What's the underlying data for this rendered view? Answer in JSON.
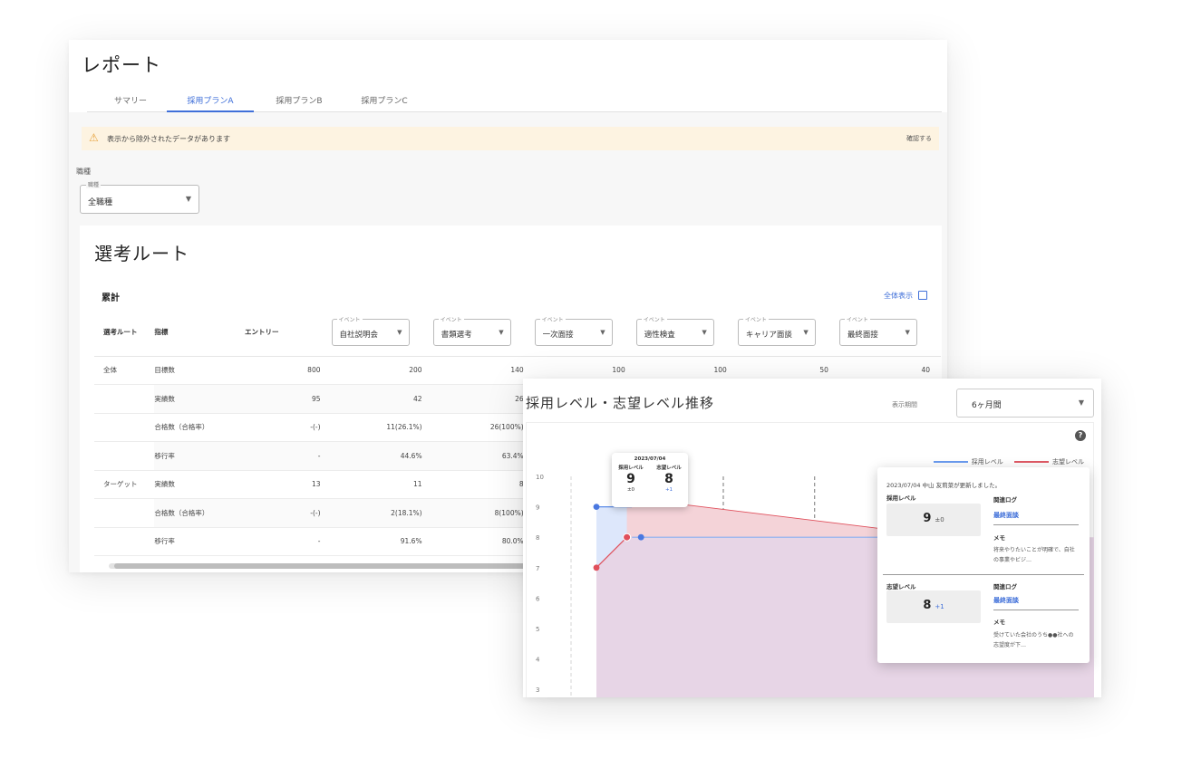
{
  "report": {
    "title": "レポート",
    "tabs": [
      "サマリー",
      "採用プランA",
      "採用プランB",
      "採用プランC"
    ],
    "active_tab": 1,
    "warning": {
      "text": "表示から除外されたデータがあります",
      "action": "確認する"
    },
    "job_type": {
      "section_label": "職種",
      "field_label": "職種",
      "value": "全職種"
    },
    "route": {
      "title": "選考ルート",
      "subtitle": "累計",
      "full_view": "全体表示",
      "headers": [
        "選考ルート",
        "指標",
        "エントリー"
      ],
      "event_label": "イベント",
      "events": [
        "自社説明会",
        "書類選考",
        "一次面接",
        "適性検査",
        "キャリア面談",
        "最終面接"
      ],
      "rows": [
        {
          "group": "全体",
          "metric": "目標数",
          "values": [
            "800",
            "200",
            "140",
            "100",
            "100",
            "50",
            "40"
          ]
        },
        {
          "group": "",
          "metric": "実績数",
          "values": [
            "95",
            "42",
            "26",
            "",
            "",
            "",
            ""
          ]
        },
        {
          "group": "",
          "metric": "合格数（合格率）",
          "values": [
            "-(-)",
            "11(26.1%)",
            "26(100%)",
            "",
            "",
            "",
            ""
          ]
        },
        {
          "group": "",
          "metric": "移行率",
          "values": [
            "-",
            "44.6%",
            "63.4%",
            "",
            "",
            "",
            ""
          ]
        },
        {
          "group": "ターゲット",
          "metric": "実績数",
          "values": [
            "13",
            "11",
            "8",
            "",
            "",
            "",
            ""
          ]
        },
        {
          "group": "",
          "metric": "合格数（合格率）",
          "values": [
            "-(-)",
            "2(18.1%)",
            "8(100%)",
            "",
            "",
            "",
            ""
          ]
        },
        {
          "group": "",
          "metric": "移行率",
          "values": [
            "-",
            "91.6%",
            "80.0%",
            "",
            "",
            "",
            ""
          ]
        }
      ]
    }
  },
  "trend": {
    "title": "採用レベル・志望レベル推移",
    "period_label": "表示期間",
    "period_value": "6ヶ月間",
    "help": "?",
    "legend": [
      {
        "name": "採用レベル",
        "color": "#6b9cf0"
      },
      {
        "name": "志望レベル",
        "color": "#e05a65"
      }
    ],
    "tooltip_small": {
      "date": "2023/07/04",
      "hire_label": "採用レベル",
      "hire_value": "9",
      "hire_delta": "±0",
      "aspire_label": "志望レベル",
      "aspire_value": "8",
      "aspire_delta": "+1"
    },
    "tooltip_detail": {
      "update_text": "2023/07/04 中山 友莉菜が更新しました。",
      "hire": {
        "label": "採用レベル",
        "value": "9",
        "delta": "±0",
        "log_label": "関連ログ",
        "log_link": "最終面談",
        "memo_label": "メモ",
        "memo_text": "将来やりたいことが明確で、自社の事業やビジ…"
      },
      "aspire": {
        "label": "志望レベル",
        "value": "8",
        "delta": "+1",
        "log_label": "関連ログ",
        "log_link": "最終面談",
        "memo_label": "メモ",
        "memo_text": "受けていた会社のうち●●社への志望度が下…"
      }
    }
  },
  "chart_data": {
    "type": "line",
    "y_ticks": [
      "10",
      "9",
      "8",
      "7",
      "6",
      "5",
      "4",
      "3"
    ],
    "ylim": [
      3,
      10
    ],
    "grid": true,
    "legend_position": "top-right",
    "series": [
      {
        "name": "採用レベル",
        "color": "#5b8be8",
        "x": [
          0,
          0.7,
          3.5
        ],
        "values": [
          9,
          8,
          8
        ]
      },
      {
        "name": "志望レベル",
        "color": "#e0505c",
        "x": [
          0,
          0.6,
          3.5
        ],
        "values": [
          7,
          8,
          8
        ]
      }
    ],
    "upper_band_top": [
      9,
      9.3,
      8
    ]
  }
}
